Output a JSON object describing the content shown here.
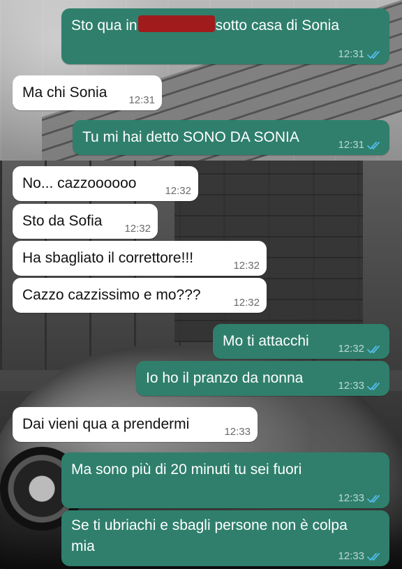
{
  "messages": [
    {
      "side": "out",
      "text_before": "Sto qua in",
      "text_after": "sotto casa di Sonia",
      "time": "12:31",
      "status": "read",
      "redacted": true
    },
    {
      "side": "in",
      "text": "Ma chi Sonia",
      "time": "12:31"
    },
    {
      "side": "out",
      "text": "Tu mi hai detto SONO DA SONIA",
      "time": "12:31",
      "status": "read"
    },
    {
      "side": "in",
      "text": "No... cazzoooooo",
      "time": "12:32"
    },
    {
      "side": "in",
      "text": "Sto da Sofia",
      "time": "12:32"
    },
    {
      "side": "in",
      "text": "Ha sbagliato il correttore!!!",
      "time": "12:32"
    },
    {
      "side": "in",
      "text": "Cazzo cazzissimo e mo???",
      "time": "12:32"
    },
    {
      "side": "out",
      "text": "Mo ti attacchi",
      "time": "12:32",
      "status": "read"
    },
    {
      "side": "out",
      "text": "Io ho il pranzo da nonna",
      "time": "12:33",
      "status": "read"
    },
    {
      "side": "in",
      "text": "Dai vieni qua a prendermi",
      "time": "12:33"
    },
    {
      "side": "out",
      "text": "Ma sono più di 20 minuti tu sei fuori",
      "time": "12:33",
      "status": "read"
    },
    {
      "side": "out",
      "text": "Se ti ubriachi e sbagli persone non è colpa mia",
      "time": "12:33",
      "status": "read"
    }
  ],
  "colors": {
    "outgoing_bubble": "#2f7f6c",
    "incoming_bubble": "#ffffff",
    "read_ticks": "#53bdeb",
    "redaction": "#a01b1b"
  },
  "icons": {
    "read_receipt": "double-check-icon"
  }
}
